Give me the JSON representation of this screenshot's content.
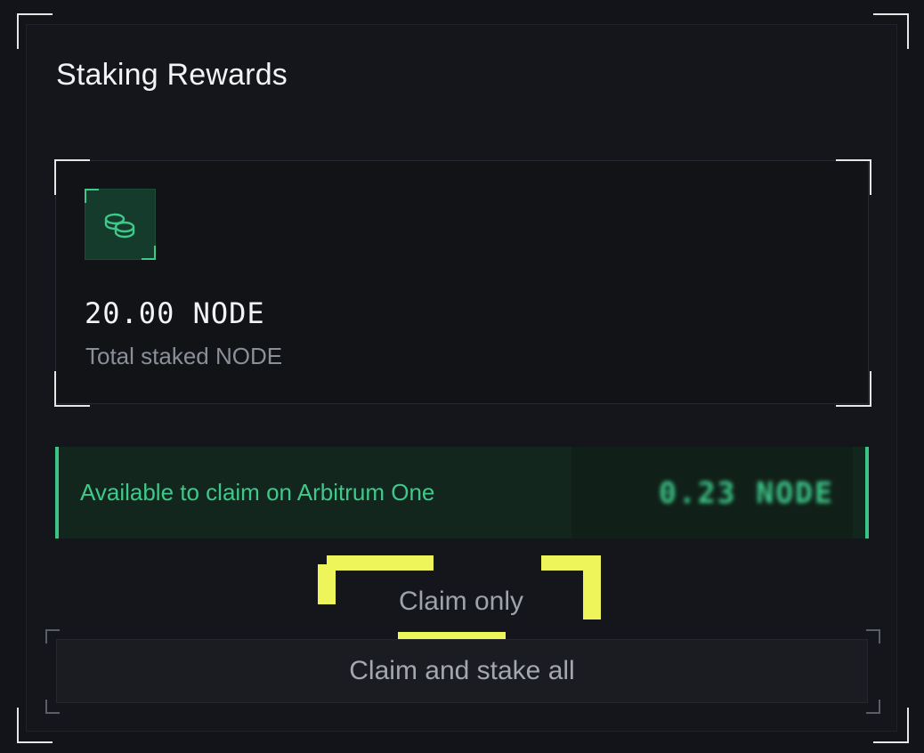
{
  "panel": {
    "title": "Staking Rewards"
  },
  "staked": {
    "icon": "coins-icon",
    "amount": "20.00 NODE",
    "label": "Total staked NODE"
  },
  "claimable": {
    "label": "Available to claim on Arbitrum One",
    "value": "0.23 NODE"
  },
  "actions": {
    "claim_only": "Claim only",
    "claim_and_stake": "Claim and stake all"
  },
  "colors": {
    "accent": "#3ec98a",
    "highlight": "#eef55a",
    "background": "#121419"
  }
}
